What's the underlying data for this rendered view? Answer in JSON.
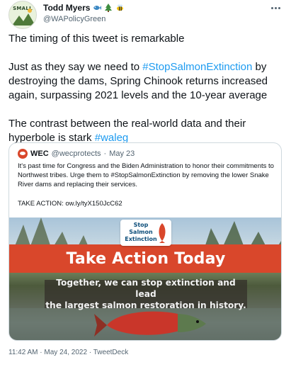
{
  "author": {
    "display_name": "Todd Myers",
    "handle": "@WAPolicyGreen",
    "avatar_text": "SMALL",
    "emoji_icons": [
      "fish-icon",
      "tree-icon",
      "bee-icon"
    ]
  },
  "tweet": {
    "line1": "The timing of this tweet is remarkable",
    "p2_before": "Just as they say we need to ",
    "p2_hashtag": "#StopSalmonExtinction",
    "p2_after": " by destroying the dams, Spring Chinook returns increased again, surpassing 2021 levels and the 10-year average",
    "p3_before": "The contrast between the real-world data and their hyperbole is stark ",
    "p3_hashtag": "#waleg"
  },
  "quoted": {
    "name": "WEC",
    "handle": "@wecprotects",
    "separator": "·",
    "date": "May 23",
    "text": "It's past time for Congress and the Biden Administration to honor their commitments to Northwest tribes. Urge them to #StopSalmonExtinction by removing the lower Snake River dams and replacing their services.",
    "cta": "TAKE ACTION: ow.ly/tyX150JcC62",
    "image": {
      "logo_text": "Stop Salmon Extinction",
      "banner": "Take Action Today",
      "sub": "Together, we can stop extinction and lead\nthe largest salmon restoration in history."
    }
  },
  "footer": {
    "time": "11:42 AM",
    "sep1": " · ",
    "date": "May 24, 2022",
    "sep2": " · ",
    "source": "TweetDeck"
  },
  "colors": {
    "link": "#1d9bf0",
    "banner": "#d9472b",
    "muted": "#536471"
  }
}
